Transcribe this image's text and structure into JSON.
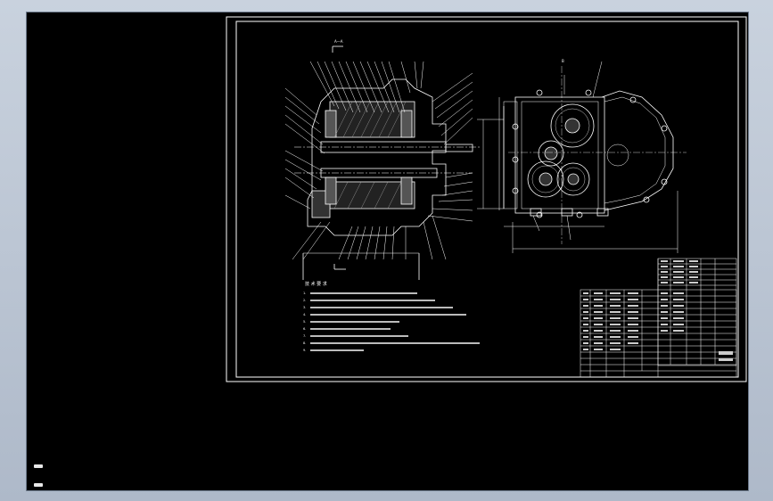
{
  "app": {
    "window": "cad-drawing-viewer",
    "background_color": "#000000",
    "line_color": "#ffffff"
  },
  "drawing": {
    "view_1_label": "A—A",
    "view_2_label": "B",
    "notes_heading": "技 术 要 求",
    "notes": [
      "1.",
      "2.",
      "3.",
      "4.",
      "5.",
      "6.",
      "7.",
      "8.",
      "9."
    ]
  },
  "icons": {
    "ucs_marker_top": "ucs-marker-icon",
    "ucs_marker_bottom": "ucs-marker-icon"
  }
}
